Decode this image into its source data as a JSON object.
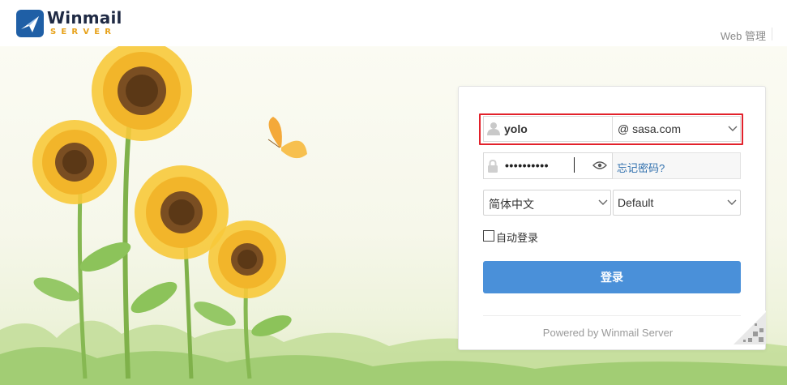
{
  "header": {
    "logo_word": "Winmail",
    "logo_sub": "SERVER",
    "web_admin_label": "Web 管理"
  },
  "login": {
    "username_value": "yolo",
    "domain_value": "@ sasa.com",
    "password_masked": "••••••••••",
    "forgot_label": "忘记密码?",
    "language_value": "简体中文",
    "skin_value": "Default",
    "auto_login_label": "自动登录",
    "submit_label": "登录",
    "powered_by": "Powered by Winmail Server"
  },
  "colors": {
    "accent": "#4a90d9",
    "highlight": "#e2212b",
    "logo_dark": "#1f2a44",
    "logo_gold": "#e7a21b",
    "link": "#2f6fad"
  }
}
